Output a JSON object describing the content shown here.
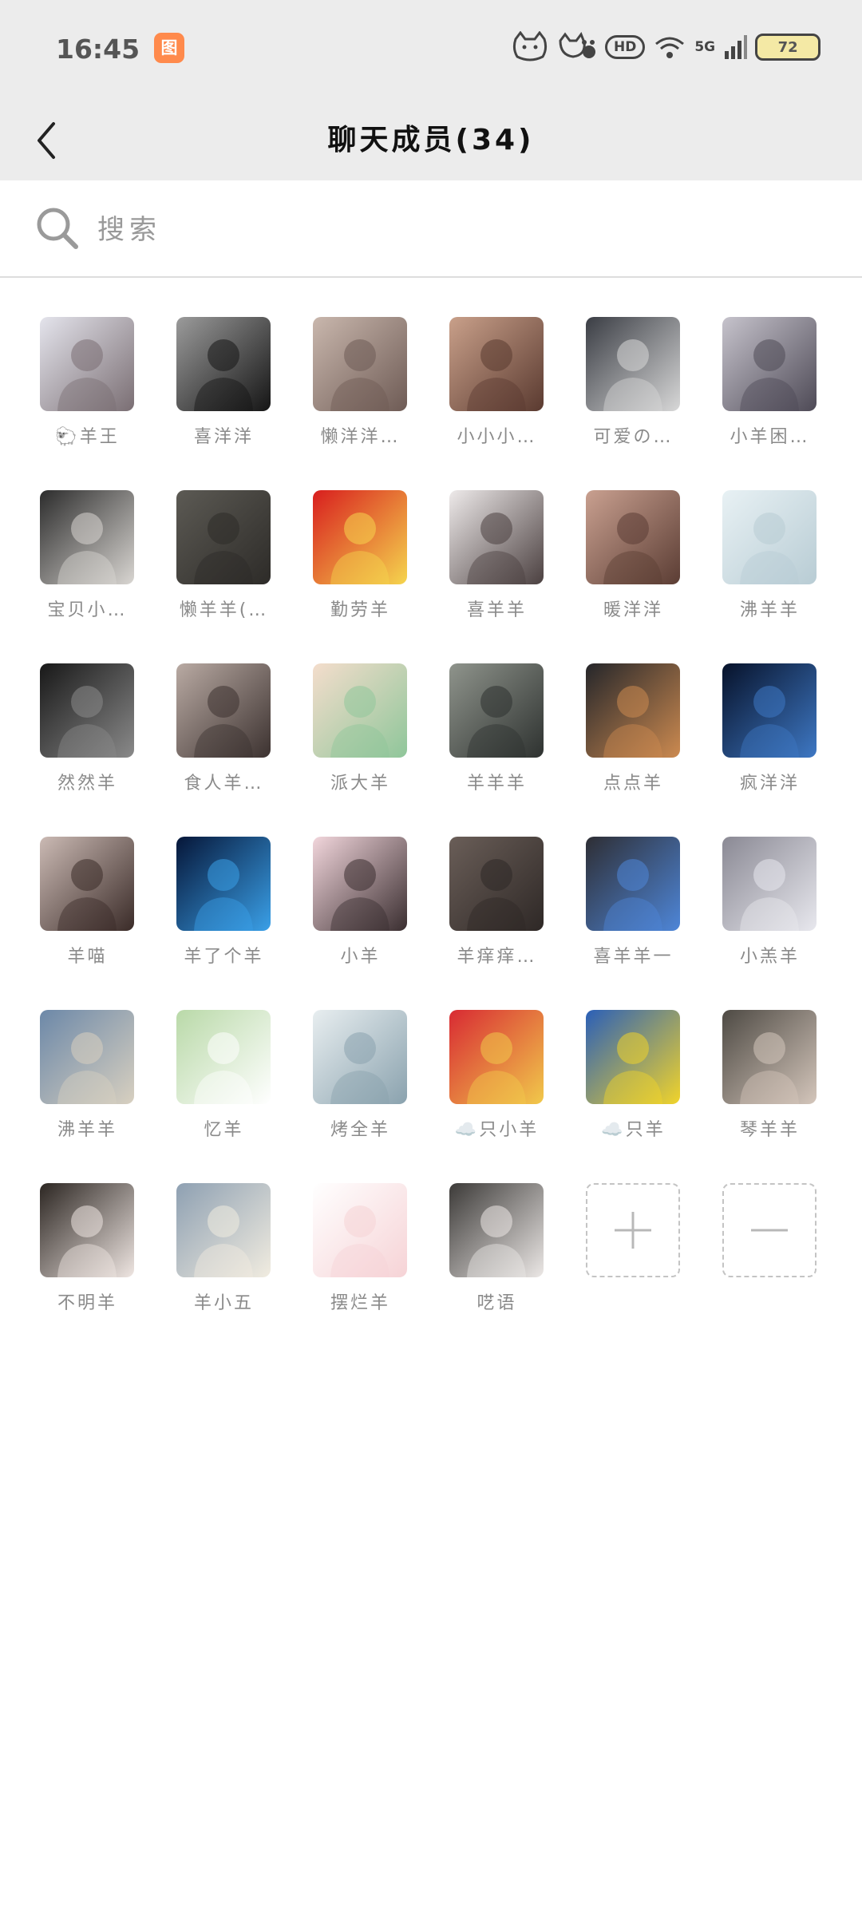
{
  "status_bar": {
    "time": "16:45",
    "app_badge": "图",
    "hd": "HD",
    "network": "5G",
    "battery": "72"
  },
  "header": {
    "title": "聊天成员(34)"
  },
  "search": {
    "placeholder": "搜索"
  },
  "members": [
    {
      "name": "🐑羊王",
      "avatar": "girl-hug-icon",
      "colors": [
        "#e4e4ec",
        "#7a6e73"
      ]
    },
    {
      "name": "喜洋洋",
      "avatar": "dark-silhouette-icon",
      "colors": [
        "#9b9b9b",
        "#151515"
      ]
    },
    {
      "name": "懒洋洋…",
      "avatar": "boy-portrait-icon",
      "colors": [
        "#c9b7ad",
        "#6e5b55"
      ]
    },
    {
      "name": "小小小…",
      "avatar": "anime-girl-icon",
      "colors": [
        "#c9a08a",
        "#5a3a30"
      ]
    },
    {
      "name": "可爱の…",
      "avatar": "boy-night-icon",
      "colors": [
        "#3a3d44",
        "#d8d8d8"
      ]
    },
    {
      "name": "小羊困…",
      "avatar": "couple-hug-icon",
      "colors": [
        "#c6c3cc",
        "#4e4a56"
      ]
    },
    {
      "name": "宝贝小…",
      "avatar": "cap-girl-icon",
      "colors": [
        "#2c2c2c",
        "#d9d6d2"
      ]
    },
    {
      "name": "懒羊羊(…",
      "avatar": "mirror-selfie-icon",
      "colors": [
        "#5c5a54",
        "#2d2b28"
      ]
    },
    {
      "name": "勤劳羊",
      "avatar": "flag-icon",
      "colors": [
        "#d81e1e",
        "#f5d54e"
      ]
    },
    {
      "name": "喜羊羊",
      "avatar": "girl-bunny-icon",
      "colors": [
        "#eeeaea",
        "#4b4040"
      ]
    },
    {
      "name": "暖洋洋",
      "avatar": "couple-kiss-icon",
      "colors": [
        "#c9a090",
        "#5b3d34"
      ]
    },
    {
      "name": "沸羊羊",
      "avatar": "placeholder-icon",
      "colors": [
        "#e8f1f4",
        "#b8ccd4"
      ]
    },
    {
      "name": "然然羊",
      "avatar": "dark-selfie-icon",
      "colors": [
        "#181818",
        "#8a8a8a"
      ]
    },
    {
      "name": "食人羊…",
      "avatar": "girl-pose-icon",
      "colors": [
        "#b9aaa3",
        "#3c3230"
      ]
    },
    {
      "name": "派大羊",
      "avatar": "baby-cartoon-icon",
      "colors": [
        "#f4ddcc",
        "#8fc69a"
      ]
    },
    {
      "name": "羊羊羊",
      "avatar": "girl-rain-icon",
      "colors": [
        "#8f948c",
        "#2e3230"
      ]
    },
    {
      "name": "点点羊",
      "avatar": "sunset-boy-icon",
      "colors": [
        "#25262a",
        "#cc8a50"
      ]
    },
    {
      "name": "疯洋洋",
      "avatar": "earth-icon",
      "colors": [
        "#07122a",
        "#3e78c4"
      ]
    },
    {
      "name": "羊喵",
      "avatar": "girl-face-icon",
      "colors": [
        "#cbbab4",
        "#3a2b28"
      ]
    },
    {
      "name": "羊了个羊",
      "avatar": "5g-icon",
      "colors": [
        "#061638",
        "#3aa0e8"
      ]
    },
    {
      "name": "小羊",
      "avatar": "pink-girl-icon",
      "colors": [
        "#f2d6dc",
        "#3a2e30"
      ]
    },
    {
      "name": "羊痒痒…",
      "avatar": "muscle-icon",
      "colors": [
        "#6a5e58",
        "#2e2826"
      ]
    },
    {
      "name": "喜羊羊一",
      "avatar": "chanel-shirt-icon",
      "colors": [
        "#2e2e34",
        "#4e86d8"
      ]
    },
    {
      "name": "小羔羊",
      "avatar": "white-hair-icon",
      "colors": [
        "#8a8994",
        "#e8e8ee"
      ]
    },
    {
      "name": "沸羊羊",
      "avatar": "mountain-boy-icon",
      "colors": [
        "#6c88a8",
        "#d8d0c0"
      ]
    },
    {
      "name": "忆羊",
      "avatar": "swing-cartoon-icon",
      "colors": [
        "#b9d9a8",
        "#ffffff"
      ]
    },
    {
      "name": "烤全羊",
      "avatar": "astronaut-icon",
      "colors": [
        "#e8eef0",
        "#8aa2ae"
      ]
    },
    {
      "name": "☁️只小羊",
      "avatar": "luffy-icon",
      "colors": [
        "#d82a33",
        "#f1c94b"
      ]
    },
    {
      "name": "☁️只羊",
      "avatar": "cliff-celebrate-icon",
      "colors": [
        "#2a5fb8",
        "#f1d42a"
      ]
    },
    {
      "name": "琴羊羊",
      "avatar": "car-boy-icon",
      "colors": [
        "#4e4a44",
        "#d4c6bb"
      ]
    },
    {
      "name": "不明羊",
      "avatar": "sleepy-girl-icon",
      "colors": [
        "#2c2622",
        "#efe6e2"
      ]
    },
    {
      "name": "羊小五",
      "avatar": "anime-boy-moon-icon",
      "colors": [
        "#8ea0b2",
        "#f1ece0"
      ]
    },
    {
      "name": "摆烂羊",
      "avatar": "bear-cartoon-icon",
      "colors": [
        "#ffffff",
        "#f6d3d6"
      ]
    },
    {
      "name": "呓语",
      "avatar": "cap-girl-dark-icon",
      "colors": [
        "#3c3a38",
        "#ece8e6"
      ]
    }
  ],
  "actions": {
    "add": "plus-icon",
    "remove": "minus-icon",
    "border_color": "#c4c4c4"
  }
}
